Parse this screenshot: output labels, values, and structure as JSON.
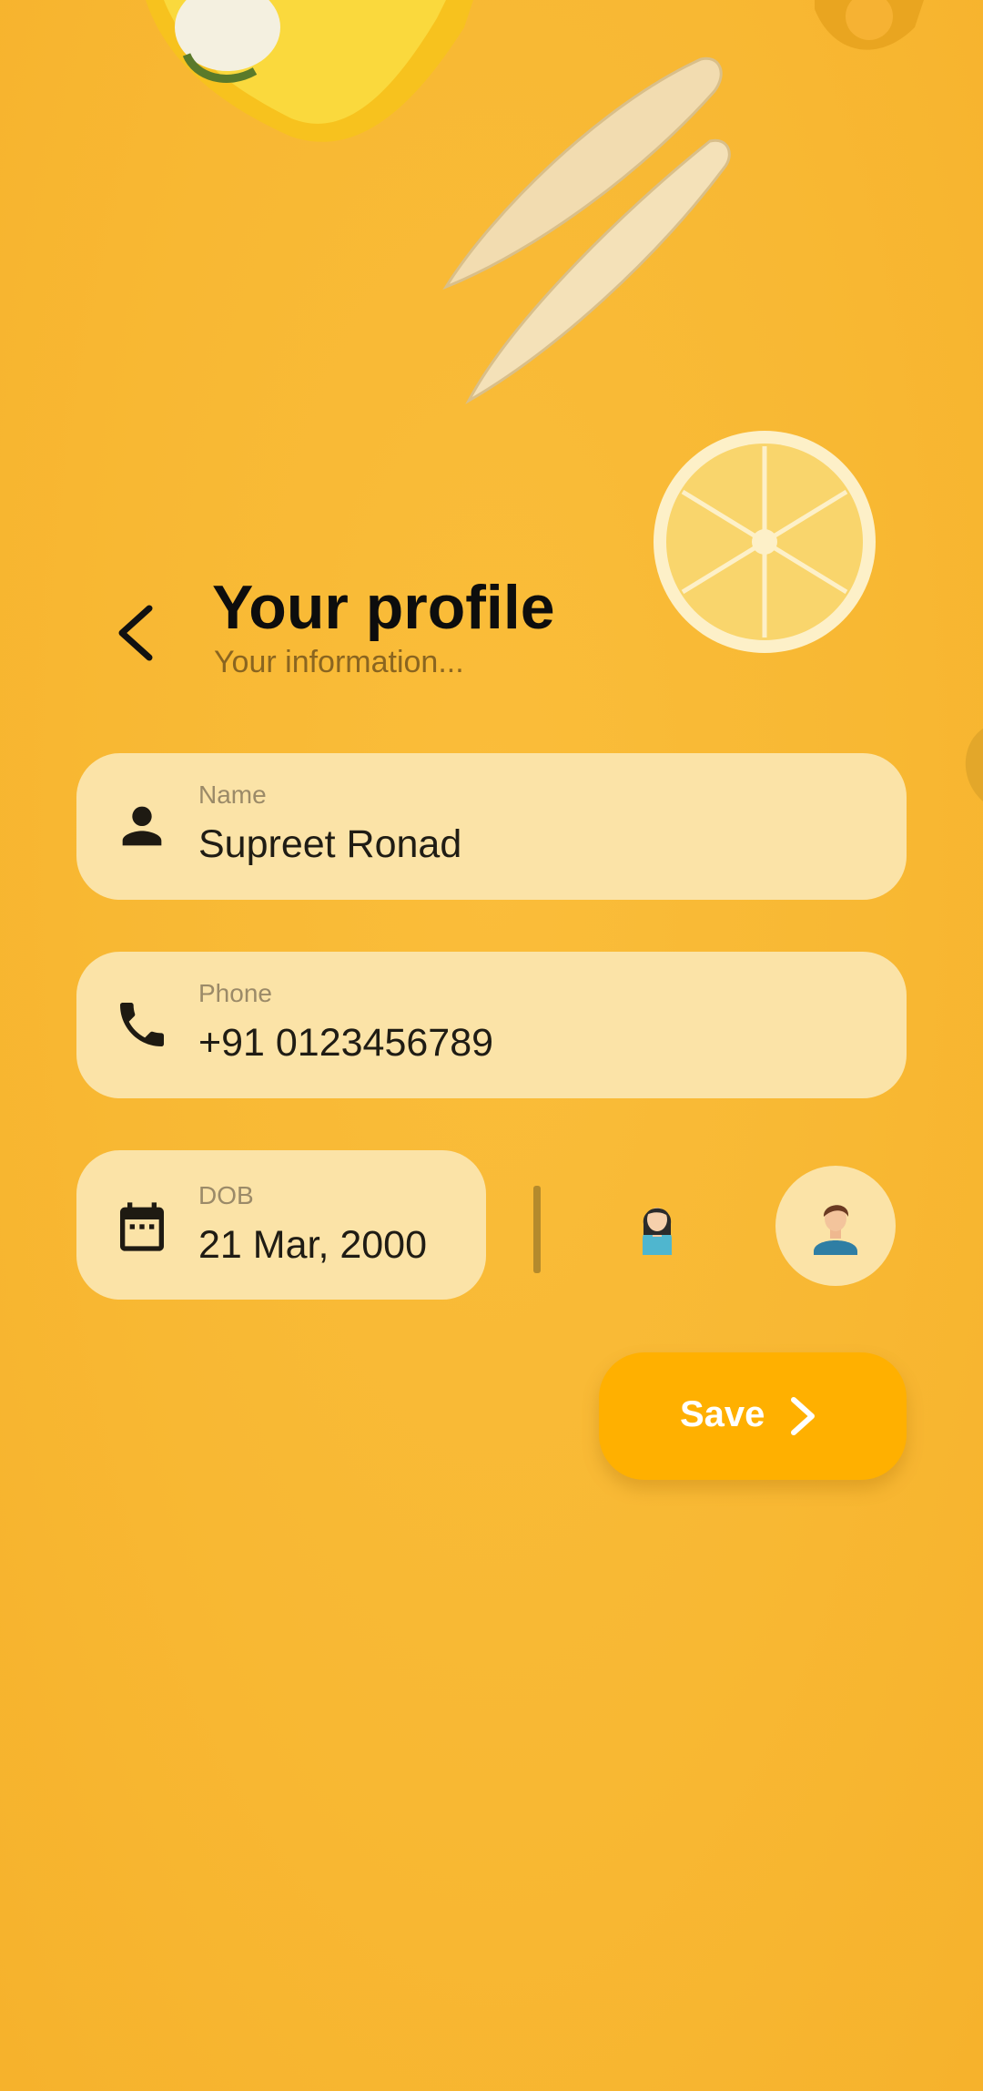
{
  "header": {
    "title": "Your profile",
    "subtitle": "Your information..."
  },
  "fields": {
    "name": {
      "label": "Name",
      "value": "Supreet Ronad",
      "icon": "person-icon"
    },
    "phone": {
      "label": "Phone",
      "value": "+91 0123456789",
      "icon": "phone-icon"
    },
    "dob": {
      "label": "DOB",
      "value": "21 Mar, 2000",
      "icon": "calendar-icon"
    }
  },
  "gender": {
    "options": [
      "female",
      "male"
    ],
    "selected": "male"
  },
  "save_button": {
    "label": "Save",
    "icon": "chevron-right-icon"
  },
  "colors": {
    "background": "#f8b935",
    "field_bg": "#fbe3a7",
    "accent": "#ffb000",
    "text": "#1f1c14",
    "label": "#9b8a68"
  }
}
